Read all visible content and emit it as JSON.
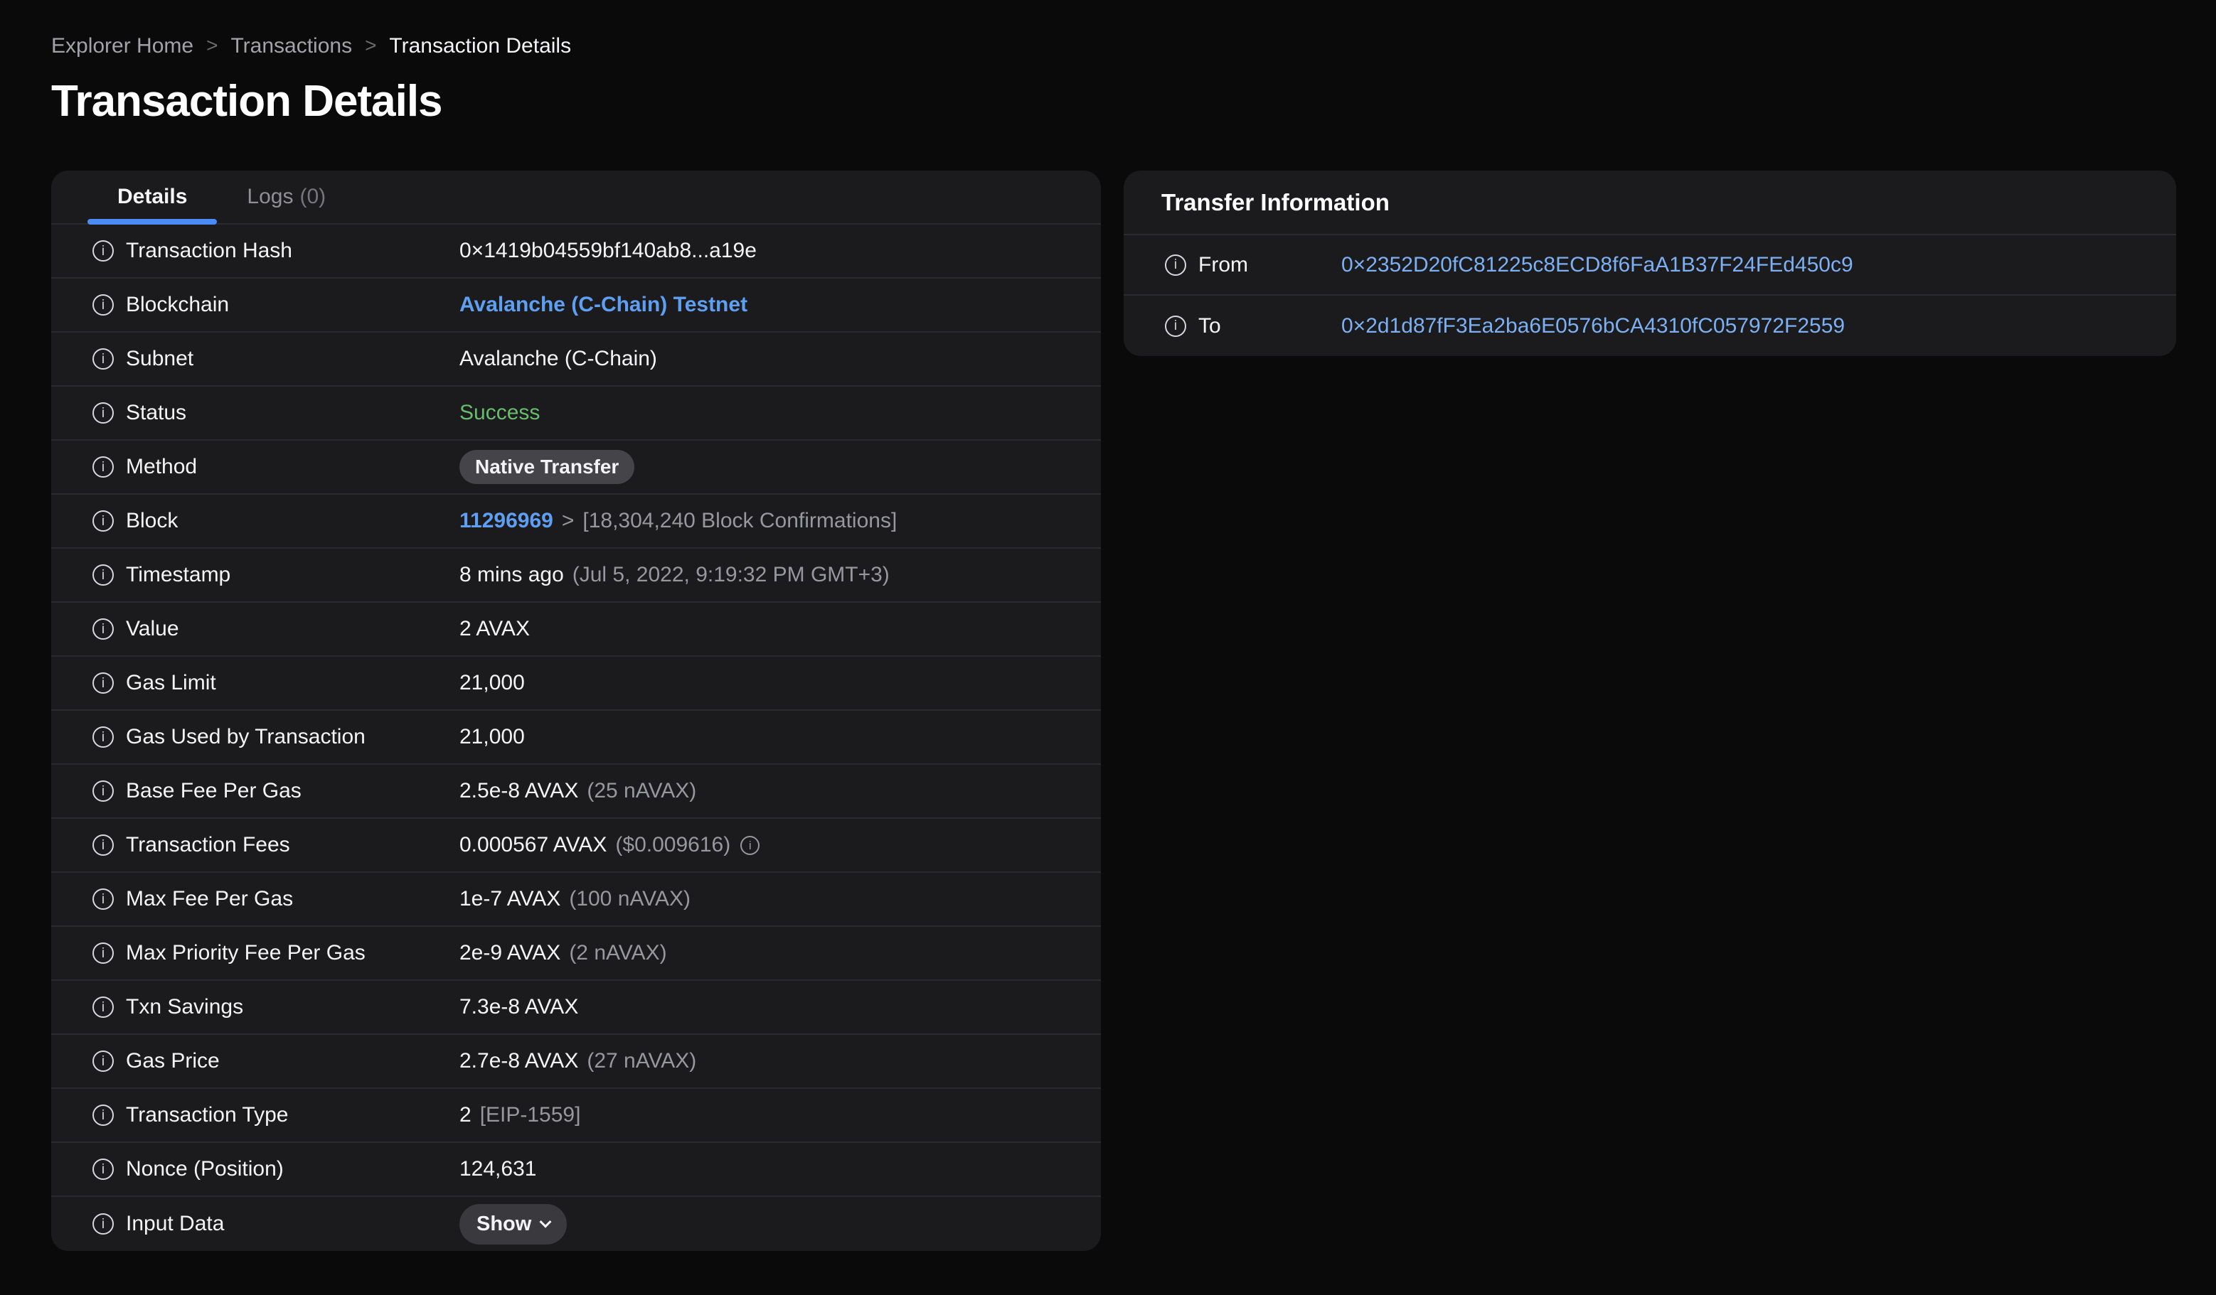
{
  "colors": {
    "bg": "#0a0a0b",
    "panel": "#1b1b1e",
    "divider": "#2b2b2f",
    "text": "#f4f4f6",
    "muted": "#97979f",
    "blue": "#7cb0f2",
    "blue_bold": "#5e9ff2",
    "underline": "#4a8bf5",
    "green": "#67bd6c",
    "badge_bg": "#454549",
    "button_bg": "#39393e"
  },
  "breadcrumb": {
    "separator": ">",
    "items": [
      {
        "label": "Explorer Home",
        "current": false
      },
      {
        "label": "Transactions",
        "current": false
      },
      {
        "label": "Transaction Details",
        "current": true
      }
    ]
  },
  "title": "Transaction Details",
  "details_panel": {
    "tabs": [
      {
        "label": "Details",
        "count": "",
        "active": true
      },
      {
        "label": "Logs",
        "count": "(0)",
        "active": false
      }
    ],
    "rows": [
      {
        "label": "Transaction Hash",
        "parts": [
          {
            "type": "text",
            "text": "0×1419b04559bf140ab8...a19e"
          }
        ]
      },
      {
        "label": "Blockchain",
        "parts": [
          {
            "type": "text",
            "tone": "linkbold",
            "text": "Avalanche (C-Chain) Testnet"
          }
        ]
      },
      {
        "label": "Subnet",
        "parts": [
          {
            "type": "text",
            "text": "Avalanche (C-Chain)"
          }
        ]
      },
      {
        "label": "Status",
        "parts": [
          {
            "type": "text",
            "tone": "green",
            "text": "Success"
          }
        ]
      },
      {
        "label": "Method",
        "parts": [
          {
            "type": "badge",
            "text": "Native Transfer"
          }
        ]
      },
      {
        "label": "Block",
        "parts": [
          {
            "type": "text",
            "tone": "linkbold",
            "text": "11296969"
          },
          {
            "type": "text",
            "tone": "gray",
            "text": ">"
          },
          {
            "type": "text",
            "tone": "gray",
            "text": "[18,304,240 Block Confirmations]"
          }
        ]
      },
      {
        "label": "Timestamp",
        "parts": [
          {
            "type": "text",
            "text": "8 mins ago"
          },
          {
            "type": "text",
            "tone": "gray",
            "text": "(Jul 5, 2022, 9:19:32 PM GMT+3)"
          }
        ]
      },
      {
        "label": "Value",
        "parts": [
          {
            "type": "text",
            "text": "2 AVAX"
          }
        ]
      },
      {
        "label": "Gas Limit",
        "parts": [
          {
            "type": "text",
            "text": "21,000"
          }
        ]
      },
      {
        "label": "Gas Used by Transaction",
        "parts": [
          {
            "type": "text",
            "text": "21,000"
          }
        ]
      },
      {
        "label": "Base Fee Per Gas",
        "parts": [
          {
            "type": "text",
            "text": "2.5e-8 AVAX"
          },
          {
            "type": "text",
            "tone": "gray",
            "text": "(25 nAVAX)"
          }
        ]
      },
      {
        "label": "Transaction Fees",
        "parts": [
          {
            "type": "text",
            "text": "0.000567 AVAX"
          },
          {
            "type": "text",
            "tone": "gray",
            "text": "($0.009616)"
          },
          {
            "type": "info"
          }
        ]
      },
      {
        "label": "Max Fee Per Gas",
        "parts": [
          {
            "type": "text",
            "text": "1e-7 AVAX"
          },
          {
            "type": "text",
            "tone": "gray",
            "text": "(100 nAVAX)"
          }
        ]
      },
      {
        "label": "Max Priority Fee Per Gas",
        "parts": [
          {
            "type": "text",
            "text": "2e-9 AVAX"
          },
          {
            "type": "text",
            "tone": "gray",
            "text": "(2 nAVAX)"
          }
        ]
      },
      {
        "label": "Txn Savings",
        "parts": [
          {
            "type": "text",
            "text": "7.3e-8 AVAX"
          }
        ]
      },
      {
        "label": "Gas Price",
        "parts": [
          {
            "type": "text",
            "text": "2.7e-8 AVAX"
          },
          {
            "type": "text",
            "tone": "gray",
            "text": "(27 nAVAX)"
          }
        ]
      },
      {
        "label": "Transaction Type",
        "parts": [
          {
            "type": "text",
            "text": "2"
          },
          {
            "type": "text",
            "tone": "gray",
            "text": "[EIP-1559]"
          }
        ]
      },
      {
        "label": "Nonce (Position)",
        "parts": [
          {
            "type": "text",
            "text": "124,631"
          }
        ]
      },
      {
        "label": "Input Data",
        "parts": [
          {
            "type": "button",
            "text": "Show"
          }
        ]
      }
    ]
  },
  "transfer_panel": {
    "title": "Transfer Information",
    "rows": [
      {
        "label": "From",
        "value": "0×2352D20fC81225c8ECD8f6FaA1B37F24FEd450c9"
      },
      {
        "label": "To",
        "value": "0×2d1d87fF3Ea2ba6E0576bCA4310fC057972F2559"
      }
    ]
  }
}
